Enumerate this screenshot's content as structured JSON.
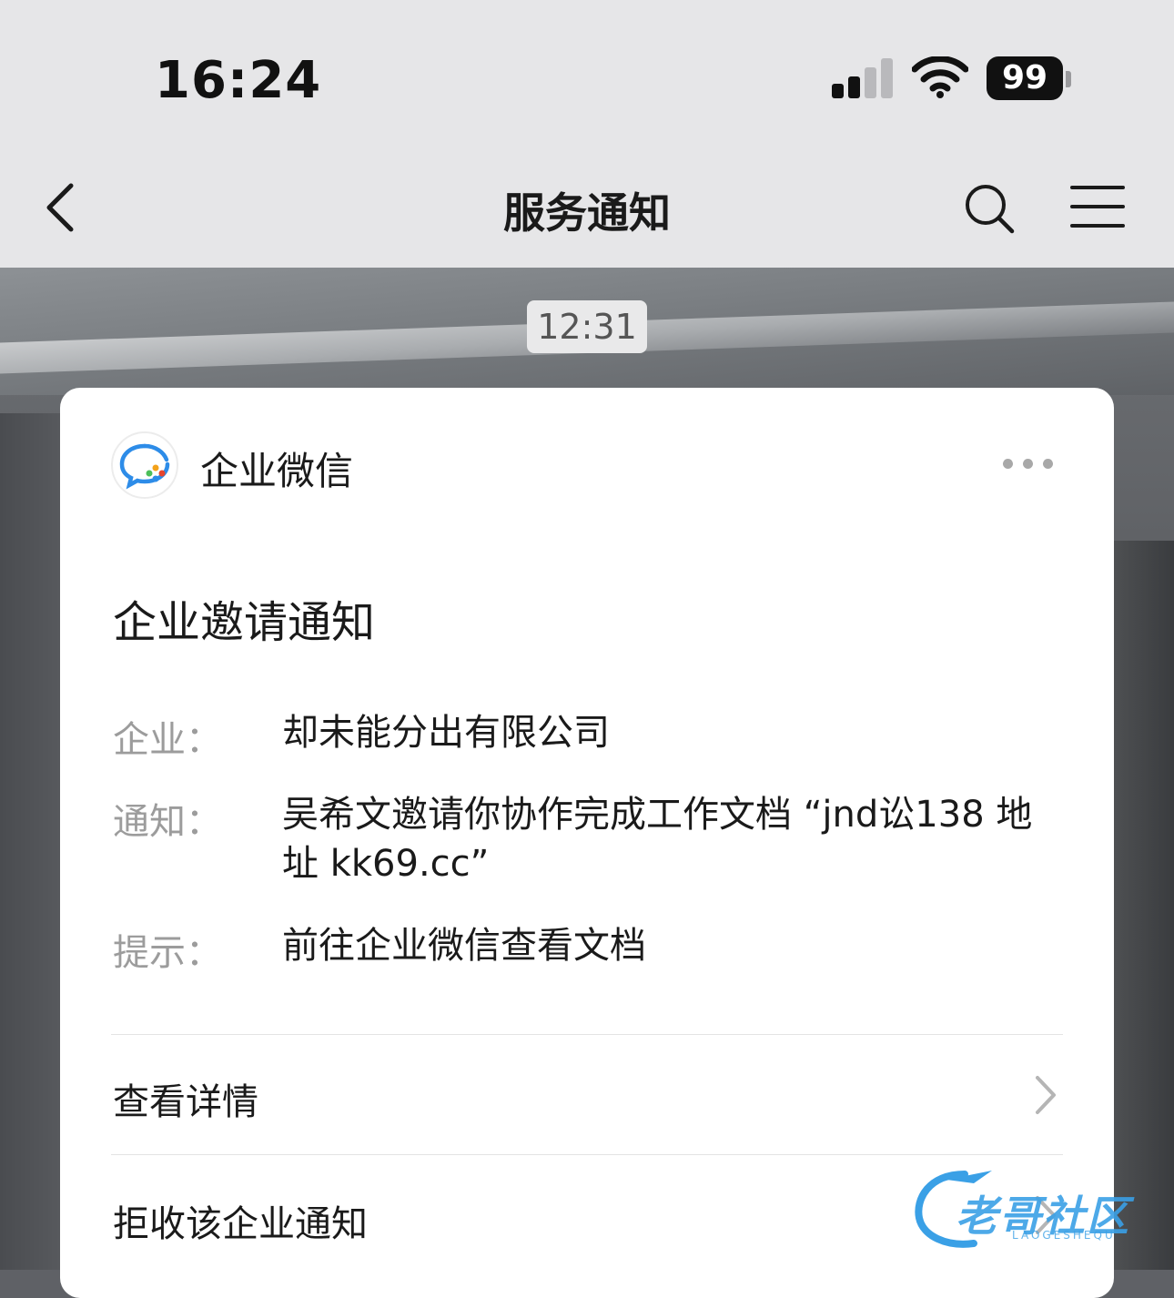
{
  "status_bar": {
    "time": "16:24",
    "battery": "99"
  },
  "nav": {
    "title": "服务通知"
  },
  "timestamp": "12:31",
  "card": {
    "app_name": "企业微信",
    "title": "企业邀请通知",
    "fields": [
      {
        "label": "企业：",
        "value": "却未能分出有限公司"
      },
      {
        "label": "通知：",
        "value": "吴希文邀请你协作完成工作文档 “jnd讼138 地址 kk69.cc”"
      },
      {
        "label": "提示：",
        "value": "前往企业微信查看文档"
      }
    ],
    "actions": {
      "view_details": "查看详情",
      "reject": "拒收该企业通知"
    }
  },
  "watermark": {
    "text": "老哥社区",
    "sub": "LAOGESHEQU"
  }
}
